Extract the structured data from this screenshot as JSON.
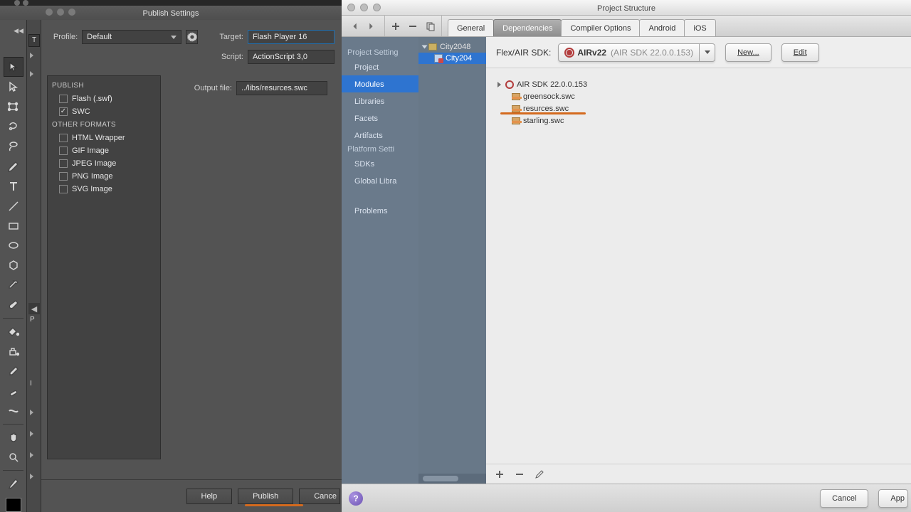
{
  "left": {
    "title": "Publish Settings",
    "profile_label": "Profile:",
    "profile_value": "Default",
    "target_label": "Target:",
    "target_value": "Flash Player 16",
    "script_label": "Script:",
    "script_value": "ActionScript 3,0",
    "output_label": "Output file:",
    "output_value": "../libs/resurces.swc",
    "publish_header": "PUBLISH",
    "other_header": "OTHER FORMATS",
    "formats": [
      {
        "label": "Flash (.swf)",
        "checked": false
      },
      {
        "label": "SWC",
        "checked": true
      },
      {
        "label": "HTML Wrapper",
        "checked": false
      },
      {
        "label": "GIF Image",
        "checked": false
      },
      {
        "label": "JPEG Image",
        "checked": false
      },
      {
        "label": "PNG Image",
        "checked": false
      },
      {
        "label": "SVG Image",
        "checked": false
      }
    ],
    "tab_stub": "T",
    "lbl_p": "P",
    "lbl_i": "I",
    "buttons": {
      "help": "Help",
      "publish": "Publish",
      "cancel": "Cance"
    }
  },
  "right": {
    "title": "Project Structure",
    "tabs": [
      "General",
      "Dependencies",
      "Compiler Options",
      "Android",
      "iOS"
    ],
    "active_tab": 1,
    "project_name": "City2048",
    "module_name": "City204",
    "sidebar": {
      "h1": "Project Setting",
      "items1": [
        "Project",
        "Modules",
        "Libraries",
        "Facets",
        "Artifacts"
      ],
      "h2": "Platform Setti",
      "items2": [
        "SDKs",
        "Global Libra"
      ],
      "items3": [
        "Problems"
      ]
    },
    "sdk_label": "Flex/AIR SDK:",
    "sdk_name": "AIRv22",
    "sdk_meta": "(AIR SDK 22.0.0.153)",
    "new_btn": "New...",
    "edit_btn": "Edit",
    "deps": [
      {
        "type": "sdk",
        "label": "AIR SDK 22.0.0.153"
      },
      {
        "type": "swc",
        "label": "greensock.swc"
      },
      {
        "type": "swc",
        "label": "resurces.swc"
      },
      {
        "type": "swc",
        "label": "starling.swc"
      }
    ],
    "foot": {
      "cancel": "Cancel",
      "apply": "App"
    }
  }
}
